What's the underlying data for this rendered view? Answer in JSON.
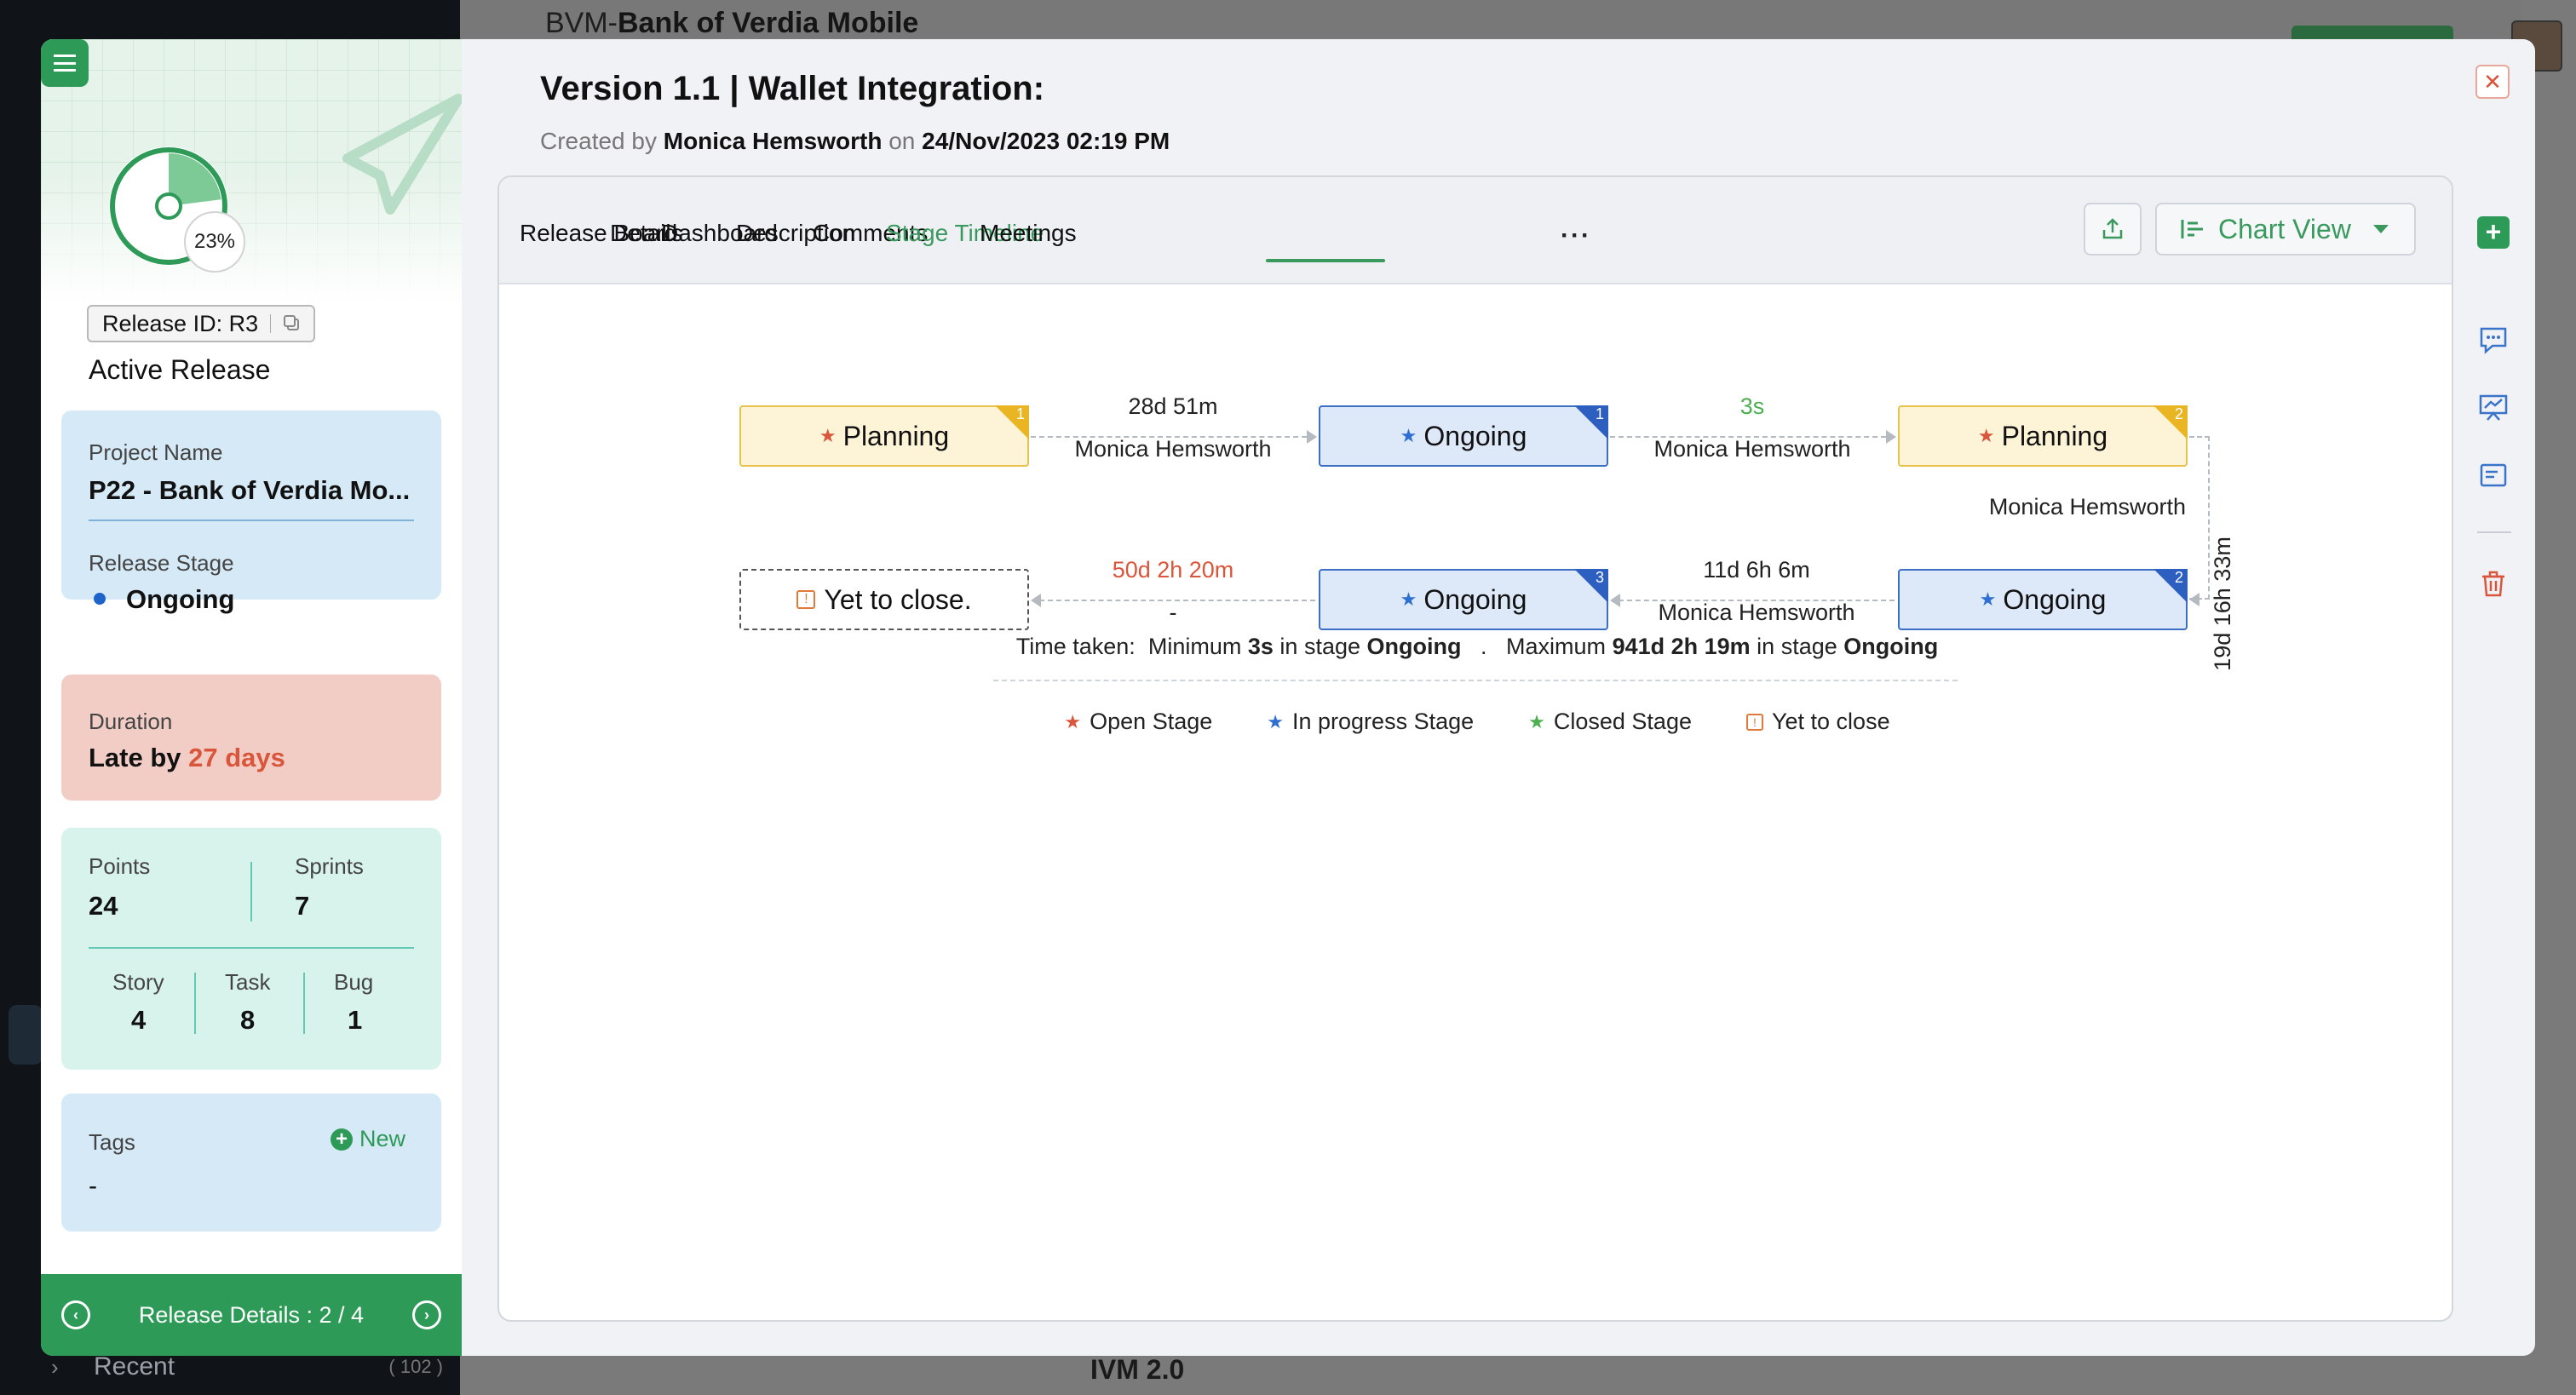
{
  "background": {
    "title_prefix": "BVM-",
    "title_name": "Bank of Verdia Mobile",
    "recent_label": "Recent",
    "recent_count": "( 102 )",
    "bottom_item": "IVM 2.0"
  },
  "left_panel": {
    "progress_percent": "23%",
    "progress_value": 0.23,
    "release_id": "Release ID: R3",
    "status_label": "Active Release",
    "project_name_label": "Project Name",
    "project_name": "P22 - Bank of Verdia Mo...",
    "release_stage_label": "Release Stage",
    "release_stage": "Ongoing",
    "duration_label": "Duration",
    "duration_prefix": "Late by",
    "duration_late": "27 days",
    "points_label": "Points",
    "points": "24",
    "sprints_label": "Sprints",
    "sprints": "7",
    "story_label": "Story",
    "story": "4",
    "task_label": "Task",
    "task": "8",
    "bug_label": "Bug",
    "bug": "1",
    "tags_label": "Tags",
    "tags_new": "New",
    "tags_value": "-",
    "footer": "Release Details : 2 / 4"
  },
  "modal": {
    "title": "Version 1.1 |  Wallet Integration:",
    "created_by_label": "Created by",
    "created_by": "Monica Hemsworth",
    "on_label": "on",
    "created_on": "24/Nov/2023 02:19 PM",
    "tabs": [
      "Release Board",
      "Details",
      "Dashboard",
      "Description",
      "Comments",
      "Stage Timeline",
      "Meetings"
    ],
    "active_tab": "Stage Timeline",
    "more": "···",
    "view_label": "Chart View"
  },
  "timeline": {
    "nodes": [
      {
        "stage": "Planning",
        "kind": "open",
        "order": "1"
      },
      {
        "stage": "Ongoing",
        "kind": "in-progress",
        "order": "1"
      },
      {
        "stage": "Planning",
        "kind": "open",
        "order": "2"
      },
      {
        "stage": "Ongoing",
        "kind": "in-progress",
        "order": "2"
      },
      {
        "stage": "Ongoing",
        "kind": "in-progress",
        "order": "3"
      },
      {
        "stage": "Yet to close.",
        "kind": "yet-to-close",
        "order": ""
      }
    ],
    "edges": [
      {
        "duration": "28d 51m",
        "by": "Monica Hemsworth"
      },
      {
        "duration": "3s",
        "by": "Monica Hemsworth"
      },
      {
        "duration": "19d 16h 33m",
        "by": "Monica Hemsworth"
      },
      {
        "duration": "11d 6h 6m",
        "by": "Monica Hemsworth"
      },
      {
        "duration": "50d 2h 20m",
        "by": "-"
      }
    ],
    "summary": {
      "label": "Time taken:",
      "min_prefix": "Minimum",
      "min_value": "3s",
      "in_stage": "in stage",
      "min_stage": "Ongoing",
      "separator": ".",
      "max_prefix": "Maximum",
      "max_value": "941d 2h 19m",
      "max_stage": "Ongoing"
    },
    "legend": [
      "Open Stage",
      "In progress Stage",
      "Closed Stage",
      "Yet to close"
    ]
  },
  "colors": {
    "brand_green": "#2e9a58",
    "open_stage": "#d9553b",
    "in_progress_stage": "#2f6fd1",
    "closed_stage": "#4caf50",
    "yet_to_close": "#e07a3a"
  }
}
